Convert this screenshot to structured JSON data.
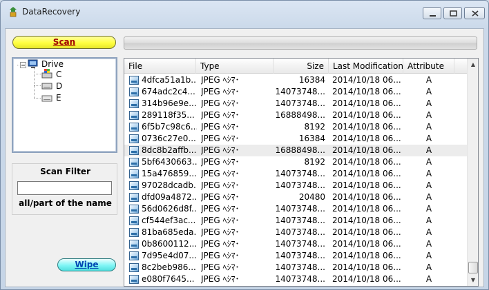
{
  "window": {
    "title": "DataRecovery"
  },
  "toolbar": {
    "scan_label": "Scan",
    "wipe_label": "Wipe"
  },
  "tree": {
    "root": "Drive",
    "drives": [
      "C",
      "D",
      "E"
    ]
  },
  "filter": {
    "title": "Scan Filter",
    "value": "",
    "hint": "all/part of the name"
  },
  "list": {
    "columns": [
      "File",
      "Type",
      "Size",
      "Last Modification",
      "Attribute"
    ],
    "rows": [
      {
        "file": "4dfca51a1b...",
        "type": "JPEG ﾍｼﾏ･",
        "size": "16384",
        "date": "2014/10/18 06...",
        "attr": "A"
      },
      {
        "file": "674adc2c4...",
        "type": "JPEG ﾍｼﾏ･",
        "size": "14073748...",
        "date": "2014/10/18 06...",
        "attr": "A"
      },
      {
        "file": "314b96e9e...",
        "type": "JPEG ﾍｼﾏ･",
        "size": "14073748...",
        "date": "2014/10/18 06...",
        "attr": "A"
      },
      {
        "file": "289118f35...",
        "type": "JPEG ﾍｼﾏ･",
        "size": "16888498...",
        "date": "2014/10/18 06...",
        "attr": "A"
      },
      {
        "file": "6f5b7c98c6...",
        "type": "JPEG ﾍｼﾏ･",
        "size": "8192",
        "date": "2014/10/18 06...",
        "attr": "A"
      },
      {
        "file": "0736c27e0...",
        "type": "JPEG ﾍｼﾏ･",
        "size": "16384",
        "date": "2014/10/18 06...",
        "attr": "A"
      },
      {
        "file": "8dc8b2affb...",
        "type": "JPEG ﾍｼﾏ･",
        "size": "16888498...",
        "date": "2014/10/18 06...",
        "attr": "A",
        "selected": true
      },
      {
        "file": "5bf6430663...",
        "type": "JPEG ﾍｼﾏ･",
        "size": "8192",
        "date": "2014/10/18 06...",
        "attr": "A"
      },
      {
        "file": "15a476859...",
        "type": "JPEG ﾍｼﾏ･",
        "size": "14073748...",
        "date": "2014/10/18 06...",
        "attr": "A"
      },
      {
        "file": "97028dcadb...",
        "type": "JPEG ﾍｼﾏ･",
        "size": "14073748...",
        "date": "2014/10/18 06...",
        "attr": "A"
      },
      {
        "file": "dfd09a4872...",
        "type": "JPEG ﾍｼﾏ･",
        "size": "20480",
        "date": "2014/10/18 06...",
        "attr": "A"
      },
      {
        "file": "56d0626d8f...",
        "type": "JPEG ﾍｼﾏ･",
        "size": "14073748...",
        "date": "2014/10/18 06...",
        "attr": "A"
      },
      {
        "file": "cf544ef3ac...",
        "type": "JPEG ﾍｼﾏ･",
        "size": "14073748...",
        "date": "2014/10/18 06...",
        "attr": "A"
      },
      {
        "file": "81ba685eda...",
        "type": "JPEG ﾍｼﾏ･",
        "size": "14073748...",
        "date": "2014/10/18 06...",
        "attr": "A"
      },
      {
        "file": "0b8600112...",
        "type": "JPEG ﾍｼﾏ･",
        "size": "14073748...",
        "date": "2014/10/18 06...",
        "attr": "A"
      },
      {
        "file": "7d95e4d07...",
        "type": "JPEG ﾍｼﾏ･",
        "size": "14073748...",
        "date": "2014/10/18 06...",
        "attr": "A"
      },
      {
        "file": "8c2beb986...",
        "type": "JPEG ﾍｼﾏ･",
        "size": "14073748...",
        "date": "2014/10/18 06...",
        "attr": "A"
      },
      {
        "file": "e080f7645...",
        "type": "JPEG ﾍｼﾏ･",
        "size": "14073748...",
        "date": "2014/10/18 06...",
        "attr": "A"
      }
    ]
  },
  "icons": {
    "app": "recycle-app-icon",
    "file": "image-file-icon",
    "drive": "hard-drive-icon",
    "computer": "computer-icon",
    "minimize": "minimize-icon",
    "maximize": "maximize-icon",
    "close": "close-icon"
  },
  "colors": {
    "scan_button": "#ffff40",
    "scan_text": "#a00000",
    "wipe_button": "#7ff5f5",
    "wipe_text": "#0047b3"
  }
}
